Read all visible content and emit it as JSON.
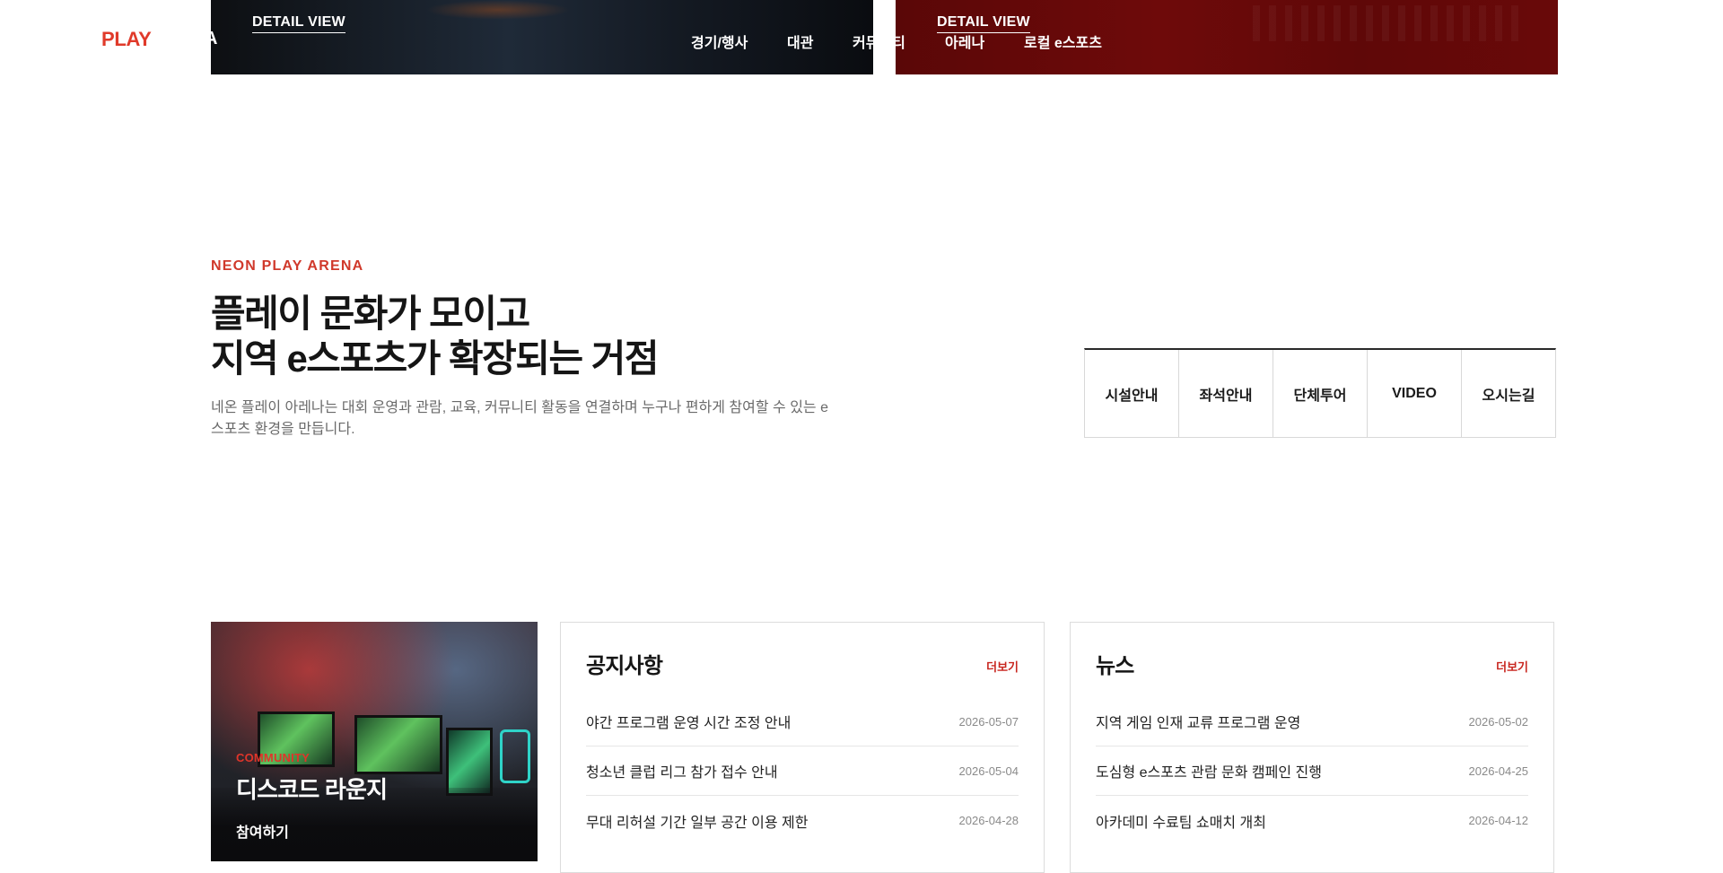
{
  "banners": {
    "left_link": "DETAIL VIEW",
    "right_link": "DETAIL VIEW"
  },
  "header": {
    "logo": "PLAY",
    "logo_fragment": "A",
    "nav": [
      "경기/행사",
      "대관",
      "커뮤니티",
      "아레나",
      "로컬 e스포츠"
    ]
  },
  "intro": {
    "eyebrow": "NEON PLAY ARENA",
    "title_line1": "플레이 문화가 모이고",
    "title_line2": "지역 e스포츠가 확장되는 거점",
    "desc": "네온 플레이 아레나는 대회 운영과 관람, 교육, 커뮤니티 활동을 연결하며 누구나 편하게 참여할 수 있는 e스포츠 환경을 만듭니다.",
    "quick_links": [
      "시설안내",
      "좌석안내",
      "단체투어",
      "VIDEO",
      "오시는길"
    ]
  },
  "promo": {
    "category": "COMMUNITY",
    "title": "디스코드 라운지",
    "button": "참여하기"
  },
  "notice": {
    "title": "공지사항",
    "more": "더보기",
    "items": [
      {
        "title": "야간 프로그램 운영 시간 조정 안내",
        "date": "2026-05-07"
      },
      {
        "title": "청소년 클럽 리그 참가 접수 안내",
        "date": "2026-05-04"
      },
      {
        "title": "무대 리허설 기간 일부 공간 이용 제한",
        "date": "2026-04-28"
      }
    ]
  },
  "news": {
    "title": "뉴스",
    "more": "더보기",
    "items": [
      {
        "title": "지역 게임 인재 교류 프로그램 운영",
        "date": "2026-05-02"
      },
      {
        "title": "도심형 e스포츠 관람 문화 캠페인 진행",
        "date": "2026-04-25"
      },
      {
        "title": "아카데미 수료팀 쇼매치 개최",
        "date": "2026-04-12"
      }
    ]
  },
  "colors": {
    "accent": "#d0392b",
    "banner_red": "#6e0a0a",
    "banner_dark": "#141a23"
  }
}
